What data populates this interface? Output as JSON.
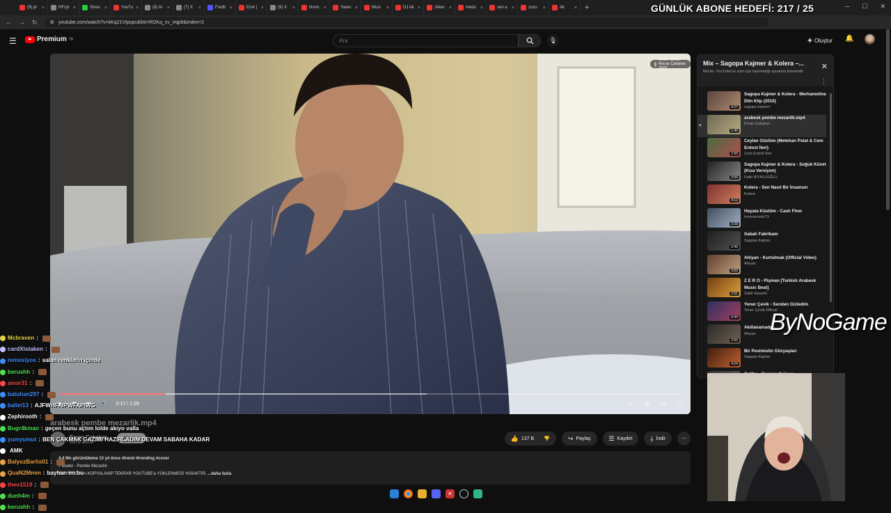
{
  "browser": {
    "tabs": [
      {
        "label": "(9) pl",
        "color": "#e33"
      },
      {
        "label": "HFzyl",
        "color": "#888"
      },
      {
        "label": "Strea",
        "color": "#2c4"
      },
      {
        "label": "YouTu",
        "color": "#e33"
      },
      {
        "label": "(8) Ar",
        "color": "#888"
      },
      {
        "label": "(7) X",
        "color": "#888"
      },
      {
        "label": "Footb",
        "color": "#55f"
      },
      {
        "label": "Emir |",
        "color": "#e33"
      },
      {
        "label": "(9) X",
        "color": "#888"
      },
      {
        "label": "Norm",
        "color": "#e33"
      },
      {
        "label": "Yaren",
        "color": "#e33"
      },
      {
        "label": "Musi",
        "color": "#e33"
      },
      {
        "label": "DJ Ak",
        "color": "#e33"
      },
      {
        "label": "Joker",
        "color": "#e33"
      },
      {
        "label": "medu",
        "color": "#e33"
      },
      {
        "label": "sen a",
        "color": "#e33"
      },
      {
        "label": "zuzu",
        "color": "#e33"
      },
      {
        "label": "Ak",
        "color": "#e33"
      }
    ],
    "url": "youtube.com/watch?v=kKq21VIpspc&list=RDKq_cv_Irqp8&index=2"
  },
  "stream_overlay": {
    "goal": "GÜNLÜK ABONE HEDEFİ: 217 / 25",
    "watermark": "ByNoGame"
  },
  "masthead": {
    "logo": "Premium",
    "logo_sup": "TR",
    "search_placeholder": "Ara",
    "create_label": "Oluştur"
  },
  "player": {
    "chip": "İnciler Cover Recep Çalışkan 2022",
    "time": "0:17 / 1:39",
    "progress": 0.172,
    "buffered": 0.59
  },
  "chat": [
    {
      "user": "Mcbraven",
      "color": "#e8d34a",
      "msg": "",
      "emote": true
    },
    {
      "user": "cardXistaken",
      "color": "#c0c0ff",
      "msg": "",
      "emote": true
    },
    {
      "user": "remoxiyos",
      "color": "#3e8cff",
      "msg": "salan renklerin içinde",
      "emote": false
    },
    {
      "user": "berushh",
      "color": "#4fe04f",
      "msg": "",
      "emote": true
    },
    {
      "user": "amsr31",
      "color": "#ff4444",
      "msg": "",
      "emote": true
    },
    {
      "user": "batuhan297",
      "color": "#3e8cff",
      "msg": "",
      "emote": true
    },
    {
      "user": "ballei13",
      "color": "#3e8cff",
      "msg": "AJFWHFAIPWFAPIWG",
      "emote": false
    },
    {
      "user": "Zephirooth",
      "color": "#ffffff",
      "msg": "",
      "emote": true
    },
    {
      "user": "Bugr4kman",
      "color": "#4fe04f",
      "msg": "geçen bunu açtım lolde akıyo valla",
      "emote": false
    },
    {
      "user": "yumyumut",
      "color": "#3e8cff",
      "msg": "BEN ÇAKMAK GAZIMI HAZIRLADIM DEVAM SABAHA KADAR",
      "emote": false
    },
    {
      "user": "",
      "color": "#ffffff",
      "msg": "AMK",
      "emote": false
    },
    {
      "user": "BalyozBarlis01",
      "color": "#e8a34a",
      "msg": "",
      "emote": true
    },
    {
      "user": "QuaN2Mmm",
      "color": "#e8a34a",
      "msg": "bayhan mı bu",
      "emote": false
    },
    {
      "user": "theo1519",
      "color": "#ff4444",
      "msg": "",
      "emote": true
    },
    {
      "user": "dunh4m",
      "color": "#4fe04f",
      "msg": "",
      "emote": true
    },
    {
      "user": "berushh",
      "color": "#4fe04f",
      "msg": "",
      "emote": true
    }
  ],
  "video": {
    "title": "arabesk pembe mezarlik.mp4",
    "channel": "Ercan Çalışkan",
    "subs": "396 B abone",
    "subscribe": "Abone ol",
    "like": "137 B",
    "share": "Paylaş",
    "save": "Kaydet",
    "download": "İndir",
    "views": "4,4 Mn görüntüleme  13 yıl önce  #trend #trending #cover",
    "music": "Model - Pembe Mezarlık",
    "desc": "BU VİDEO'nun KOPYALANIP TEKRAR YOUTUBE'a YÜKLENMESİ YASAKTIR.",
    "more": "...daha fazla"
  },
  "playlist": {
    "title": "Mix – Sagopa Kajmer & Kolera –...",
    "subtitle": "Mix'ler, YouTube'un sizin için hazırladığı oynatma listeleridir",
    "items": [
      {
        "title": "Sagopa Kajmer & Kolera - Merhametine Dön Klip (2010)",
        "author": "sagopa kajmerr",
        "dur": "4:27",
        "c1": "#5a4540",
        "c2": "#b08a70"
      },
      {
        "title": "arabesk pembe mezarlik.mp4",
        "author": "Ercan Çalışkan",
        "dur": "1:40",
        "c1": "#706a55",
        "c2": "#b5aa80",
        "active": true
      },
      {
        "title": "Ceylan Gözlüm (Metehan Polat & Cem Erdost İleri)",
        "author": "Cem Erdost İleri",
        "dur": "1:55",
        "c1": "#4a6a40",
        "c2": "#b05050"
      },
      {
        "title": "Sagopa Kajmer & Kolera - Soğuk Küvet (Kısa Versiyon)",
        "author": "Fatih BIYIKLIOĞLU",
        "dur": "3:50",
        "c1": "#222",
        "c2": "#888"
      },
      {
        "title": "Kolera - Sen Nasıl Bir İnsansın",
        "author": "Kolera",
        "dur": "4:12",
        "c1": "#803030",
        "c2": "#d08060"
      },
      {
        "title": "Hayata Küstüm - Cash Flow",
        "author": "IremrecordsTV",
        "dur": "3:28",
        "c1": "#405060",
        "c2": "#a0b0c0"
      },
      {
        "title": "Sabah Fabrikam",
        "author": "Sagopa Kajmer",
        "dur": "2:49",
        "c1": "#202020",
        "c2": "#505050"
      },
      {
        "title": "Ahiyan - Kurtulmak (Official Video)",
        "author": "Ahiyan",
        "dur": "3:59",
        "c1": "#604030",
        "c2": "#c0a080"
      },
      {
        "title": "Z E R O - Pişman [Turkish Arabesk Music Beat]",
        "author": "Sabir Hasanli",
        "dur": "2:51",
        "c1": "#704010",
        "c2": "#e0a040"
      },
      {
        "title": "Yener Çevik - Senden Gizledim",
        "author": "Yener Çevik Official",
        "dur": "3:44",
        "c1": "#303060",
        "c2": "#a04060"
      },
      {
        "title": "Akıllanamadım",
        "author": "Ahiyan",
        "dur": "2:50",
        "c1": "#2a2a2a",
        "c2": "#706050"
      },
      {
        "title": "Bir Pesimistin Gözyaşları",
        "author": "Sagopa Kajmer",
        "dur": "4:24",
        "c1": "#402010",
        "c2": "#c06030"
      },
      {
        "title": "Galiba - Sagopa Kajmer",
        "author": "",
        "dur": "",
        "c1": "#333",
        "c2": "#666"
      }
    ]
  }
}
